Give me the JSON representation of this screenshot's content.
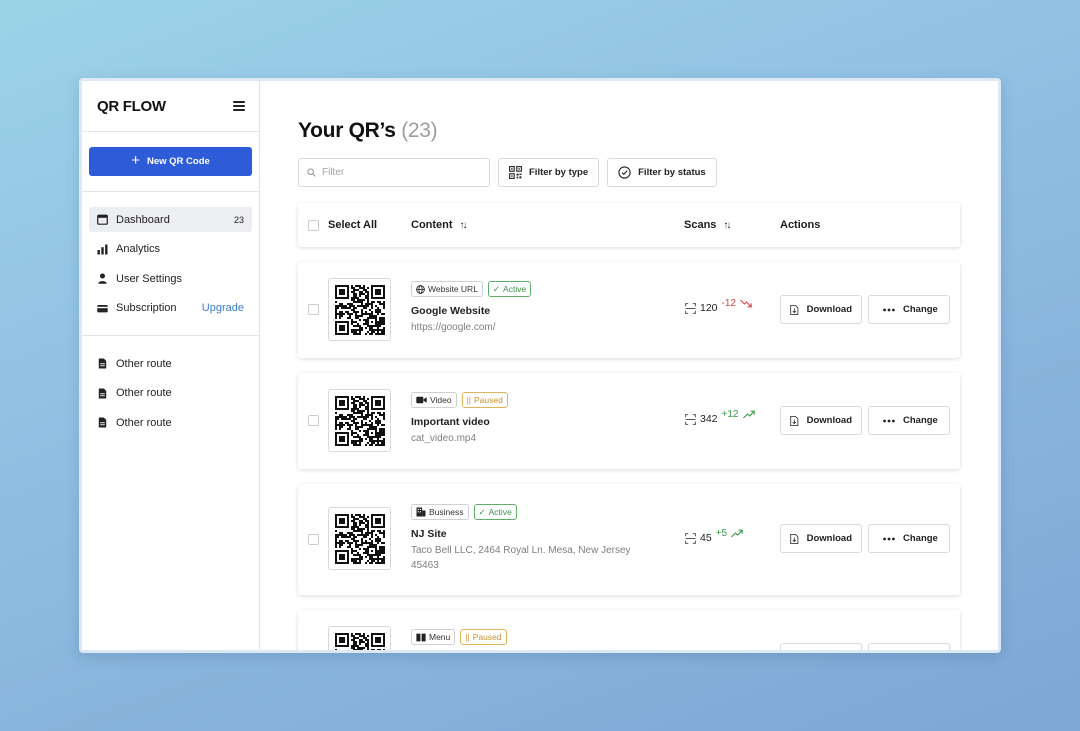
{
  "app": {
    "logo": "QR FLOW"
  },
  "sidebar": {
    "new_button": "New QR Code",
    "items": [
      {
        "label": "Dashboard",
        "count": "23",
        "icon": "calendar-icon"
      },
      {
        "label": "Analytics",
        "icon": "bar-chart-icon"
      },
      {
        "label": "User Settings",
        "icon": "user-icon"
      },
      {
        "label": "Subscription",
        "link": "Upgrade",
        "icon": "credit-card-icon"
      }
    ],
    "routes": [
      {
        "label": "Other route",
        "icon": "document-icon"
      },
      {
        "label": "Other route",
        "icon": "document-icon"
      },
      {
        "label": "Other route",
        "icon": "document-icon"
      }
    ]
  },
  "main": {
    "title": "Your QR’s",
    "count": "(23)",
    "filter_placeholder": "Filter",
    "filter_by_type": "Filter by type",
    "filter_by_status": "Filter by status",
    "table_headers": {
      "select_all": "Select All",
      "content": "Content",
      "scans": "Scans",
      "actions": "Actions"
    },
    "rows": [
      {
        "type": "Website URL",
        "type_icon": "globe-icon",
        "status": "Active",
        "status_mark": "✓",
        "title": "Google Website",
        "subtitle": "https://google.com/",
        "scans": "120",
        "delta": "-12",
        "download": "Download",
        "change": "Change"
      },
      {
        "type": "Video",
        "type_icon": "video-camera-icon",
        "status": "Paused",
        "status_mark": "||",
        "title": "Important video",
        "subtitle": "cat_video.mp4",
        "scans": "342",
        "delta": "+12",
        "download": "Download",
        "change": "Change"
      },
      {
        "type": "Business",
        "type_icon": "building-icon",
        "status": "Active",
        "status_mark": "✓",
        "title": "NJ Site",
        "subtitle": "Taco Bell LLC, 2464 Royal Ln. Mesa, New Jersey 45463",
        "scans": "45",
        "delta": "+5",
        "download": "Download",
        "change": "Change"
      },
      {
        "type": "Menu",
        "type_icon": "book-icon",
        "status": "Paused",
        "status_mark": "||"
      }
    ]
  },
  "colors": {
    "primary": "#2e5bd8",
    "active": "#3d9148",
    "paused": "#c8922f",
    "negative": "#d64545",
    "positive": "#3a9a4a",
    "link": "#3b7cc8"
  }
}
